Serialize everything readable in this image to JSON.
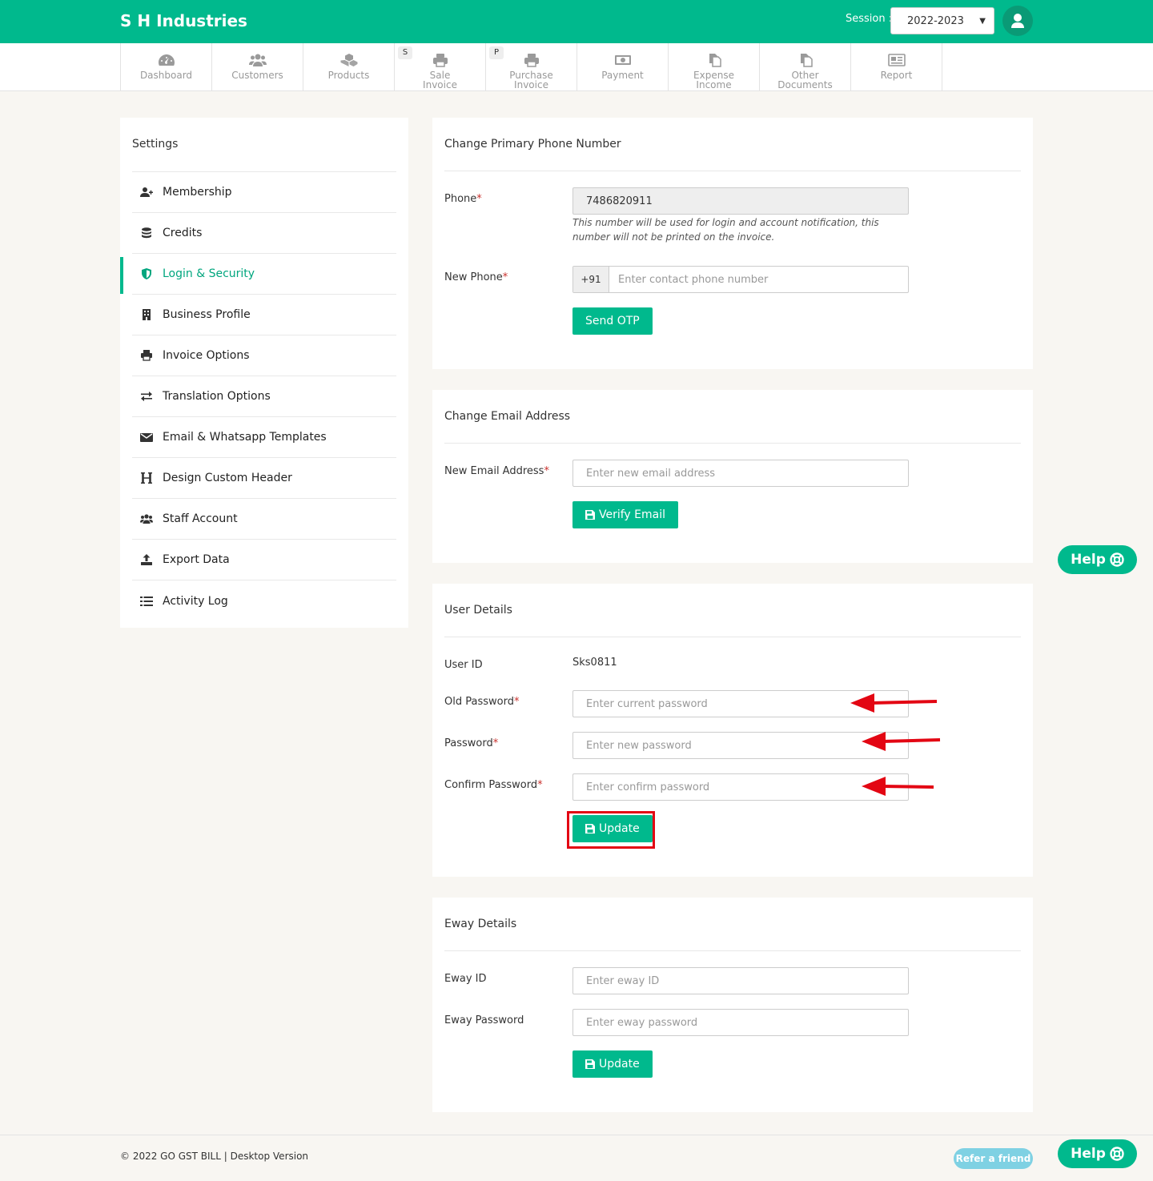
{
  "header": {
    "brand": "S H Industries",
    "session_label": "Session :",
    "session_value": "2022-2023"
  },
  "nav": [
    {
      "label": "Dashboard",
      "label2": "",
      "icon": "dashboard-icon",
      "badge": ""
    },
    {
      "label": "Customers",
      "label2": "",
      "icon": "users-icon",
      "badge": ""
    },
    {
      "label": "Products",
      "label2": "",
      "icon": "cubes-icon",
      "badge": ""
    },
    {
      "label": "Sale",
      "label2": "Invoice",
      "icon": "print-icon",
      "badge": "S"
    },
    {
      "label": "Purchase",
      "label2": "Invoice",
      "icon": "print-icon",
      "badge": "P"
    },
    {
      "label": "Payment",
      "label2": "",
      "icon": "money-icon",
      "badge": ""
    },
    {
      "label": "Expense",
      "label2": "Income",
      "icon": "files-icon",
      "badge": ""
    },
    {
      "label": "Other",
      "label2": "Documents",
      "icon": "files-icon",
      "badge": ""
    },
    {
      "label": "Report",
      "label2": "",
      "icon": "newspaper-icon",
      "badge": ""
    }
  ],
  "sidebar": {
    "title": "Settings",
    "items": [
      {
        "label": "Membership",
        "icon": "user-plus-icon"
      },
      {
        "label": "Credits",
        "icon": "database-icon"
      },
      {
        "label": "Login & Security",
        "icon": "shield-icon"
      },
      {
        "label": "Business Profile",
        "icon": "building-icon"
      },
      {
        "label": "Invoice Options",
        "icon": "print-icon"
      },
      {
        "label": "Translation Options",
        "icon": "exchange-icon"
      },
      {
        "label": "Email & Whatsapp Templates",
        "icon": "envelope-icon"
      },
      {
        "label": "Design Custom Header",
        "icon": "header-icon"
      },
      {
        "label": "Staff Account",
        "icon": "users-icon"
      },
      {
        "label": "Export Data",
        "icon": "upload-icon"
      },
      {
        "label": "Activity Log",
        "icon": "list-icon"
      }
    ]
  },
  "phone_card": {
    "title": "Change Primary Phone Number",
    "phone_label": "Phone",
    "phone_value": "7486820911",
    "help_text": "This number will be used for login and account notification, this number will not be printed on the invoice.",
    "new_phone_label": "New Phone",
    "prefix": "+91",
    "new_phone_placeholder": "Enter contact phone number",
    "send_otp": "Send OTP"
  },
  "email_card": {
    "title": "Change Email Address",
    "label": "New Email Address",
    "placeholder": "Enter new email address",
    "verify": "Verify Email"
  },
  "user_card": {
    "title": "User Details",
    "userid_label": "User ID",
    "userid_value": "Sks0811",
    "old_label": "Old Password",
    "old_placeholder": "Enter current password",
    "new_label": "Password",
    "new_placeholder": "Enter new password",
    "confirm_label": "Confirm Password",
    "confirm_placeholder": "Enter confirm password",
    "update": "Update"
  },
  "eway_card": {
    "title": "Eway Details",
    "id_label": "Eway ID",
    "id_placeholder": "Enter eway ID",
    "pwd_label": "Eway Password",
    "pwd_placeholder": "Enter eway password",
    "update": "Update"
  },
  "required_mark": "*",
  "help_label": "Help",
  "footer": {
    "text": "© 2022 GO GST BILL  |  Desktop Version",
    "refer": "Refer a friend"
  },
  "colors": {
    "primary": "#00b98d",
    "annotation_red": "#e30613"
  }
}
